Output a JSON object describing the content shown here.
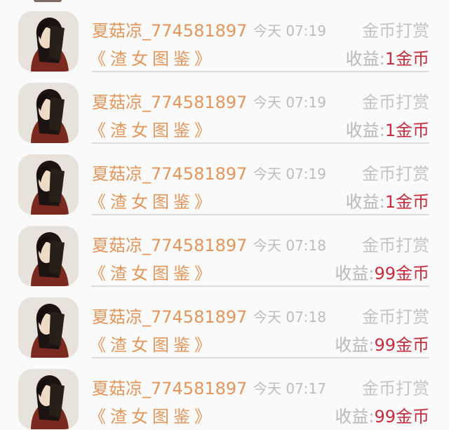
{
  "records": [
    {
      "name": "夏菇凉_774581897",
      "time": "今天 07:19",
      "type": "金币打赏",
      "book": "《渣女图鉴》",
      "earn_label": "收益:",
      "earn_value": "1金币"
    },
    {
      "name": "夏菇凉_774581897",
      "time": "今天 07:19",
      "type": "金币打赏",
      "book": "《渣女图鉴》",
      "earn_label": "收益:",
      "earn_value": "1金币"
    },
    {
      "name": "夏菇凉_774581897",
      "time": "今天 07:19",
      "type": "金币打赏",
      "book": "《渣女图鉴》",
      "earn_label": "收益:",
      "earn_value": "1金币"
    },
    {
      "name": "夏菇凉_774581897",
      "time": "今天 07:18",
      "type": "金币打赏",
      "book": "《渣女图鉴》",
      "earn_label": "收益:",
      "earn_value": "99金币"
    },
    {
      "name": "夏菇凉_774581897",
      "time": "今天 07:18",
      "type": "金币打赏",
      "book": "《渣女图鉴》",
      "earn_label": "收益:",
      "earn_value": "99金币"
    },
    {
      "name": "夏菇凉_774581897",
      "time": "今天 07:17",
      "type": "金币打赏",
      "book": "《渣女图鉴》",
      "earn_label": "收益:",
      "earn_value": "99金币"
    }
  ],
  "colors": {
    "name": "#e3965c",
    "earn_value": "#c62c3c",
    "muted": "#bdbdbd",
    "divider": "#dcdcdc"
  },
  "icons": {
    "avatar": "user-avatar-photo"
  }
}
